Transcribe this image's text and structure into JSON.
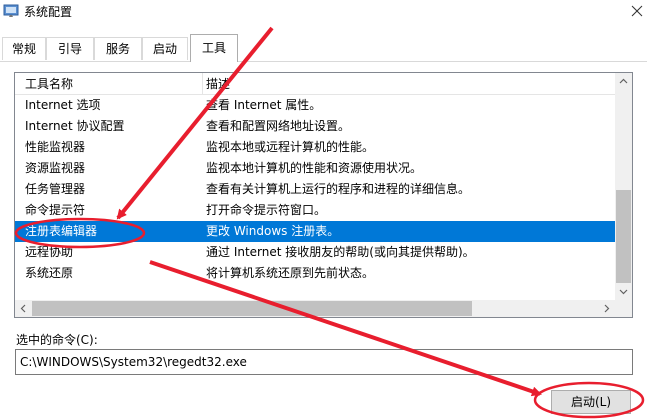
{
  "window": {
    "title": "系统配置"
  },
  "tabs": [
    {
      "label": "常规"
    },
    {
      "label": "引导"
    },
    {
      "label": "服务"
    },
    {
      "label": "启动"
    },
    {
      "label": "工具"
    }
  ],
  "list": {
    "headers": {
      "name": "工具名称",
      "desc": "描述"
    },
    "rows": [
      {
        "name": "Internet 选项",
        "desc": "查看 Internet 属性。"
      },
      {
        "name": "Internet 协议配置",
        "desc": "查看和配置网络地址设置。"
      },
      {
        "name": "性能监视器",
        "desc": "监视本地或远程计算机的性能。"
      },
      {
        "name": "资源监视器",
        "desc": "监视本地计算机的性能和资源使用状况。"
      },
      {
        "name": "任务管理器",
        "desc": "查看有关计算机上运行的程序和进程的详细信息。"
      },
      {
        "name": "命令提示符",
        "desc": "打开命令提示符窗口。"
      },
      {
        "name": "注册表编辑器",
        "desc": "更改 Windows 注册表。"
      },
      {
        "name": "远程协助",
        "desc": "通过 Internet 接收朋友的帮助(或向其提供帮助)。"
      },
      {
        "name": "系统还原",
        "desc": "将计算机系统还原到先前状态。"
      }
    ],
    "selected_index": 6
  },
  "command": {
    "label": "选中的命令(C):",
    "value": "C:\\WINDOWS\\System32\\regedt32.exe"
  },
  "launch_button": {
    "label": "启动(L)"
  },
  "colors": {
    "selection": "#0078d7",
    "annotation": "#e81e2e"
  }
}
